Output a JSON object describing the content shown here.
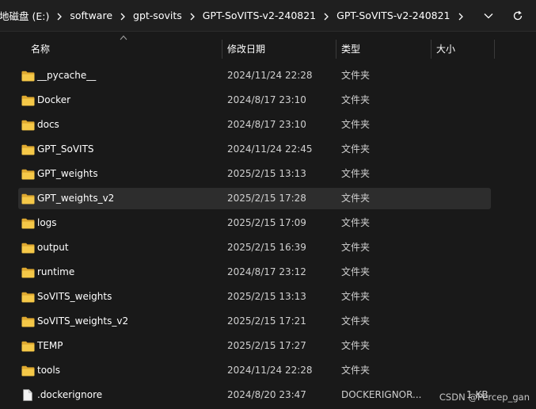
{
  "address": {
    "crumbs": [
      "地磁盘 (E:)",
      "software",
      "gpt-sovits",
      "GPT-SoVITS-v2-240821",
      "GPT-SoVITS-v2-240821"
    ],
    "icon_dropdown": "chevron-down-icon",
    "icon_refresh": "refresh-icon"
  },
  "columns": {
    "name": "名称",
    "date": "修改日期",
    "type": "类型",
    "size": "大小"
  },
  "files": [
    {
      "name": "__pycache__",
      "date": "2024/11/24 22:28",
      "type": "文件夹",
      "size": "",
      "kind": "folder"
    },
    {
      "name": "Docker",
      "date": "2024/8/17 23:10",
      "type": "文件夹",
      "size": "",
      "kind": "folder"
    },
    {
      "name": "docs",
      "date": "2024/8/17 23:10",
      "type": "文件夹",
      "size": "",
      "kind": "folder"
    },
    {
      "name": "GPT_SoVITS",
      "date": "2024/11/24 22:45",
      "type": "文件夹",
      "size": "",
      "kind": "folder"
    },
    {
      "name": "GPT_weights",
      "date": "2025/2/15 13:13",
      "type": "文件夹",
      "size": "",
      "kind": "folder"
    },
    {
      "name": "GPT_weights_v2",
      "date": "2025/2/15 17:28",
      "type": "文件夹",
      "size": "",
      "kind": "folder"
    },
    {
      "name": "logs",
      "date": "2025/2/15 17:09",
      "type": "文件夹",
      "size": "",
      "kind": "folder"
    },
    {
      "name": "output",
      "date": "2025/2/15 16:39",
      "type": "文件夹",
      "size": "",
      "kind": "folder"
    },
    {
      "name": "runtime",
      "date": "2024/8/17 23:12",
      "type": "文件夹",
      "size": "",
      "kind": "folder"
    },
    {
      "name": "SoVITS_weights",
      "date": "2025/2/15 13:13",
      "type": "文件夹",
      "size": "",
      "kind": "folder"
    },
    {
      "name": "SoVITS_weights_v2",
      "date": "2025/2/15 17:21",
      "type": "文件夹",
      "size": "",
      "kind": "folder"
    },
    {
      "name": "TEMP",
      "date": "2025/2/15 17:27",
      "type": "文件夹",
      "size": "",
      "kind": "folder"
    },
    {
      "name": "tools",
      "date": "2024/11/24 22:28",
      "type": "文件夹",
      "size": "",
      "kind": "folder"
    },
    {
      "name": ".dockerignore",
      "date": "2024/8/20 23:47",
      "type": "DOCKERIGNOR...",
      "size": "1 KB",
      "kind": "file"
    }
  ],
  "hovered_row": 5,
  "watermark": "CSDN @Percep_gan",
  "colors": {
    "background": "#191919",
    "hover": "#2d2d2d",
    "folder": "#f2c443"
  }
}
